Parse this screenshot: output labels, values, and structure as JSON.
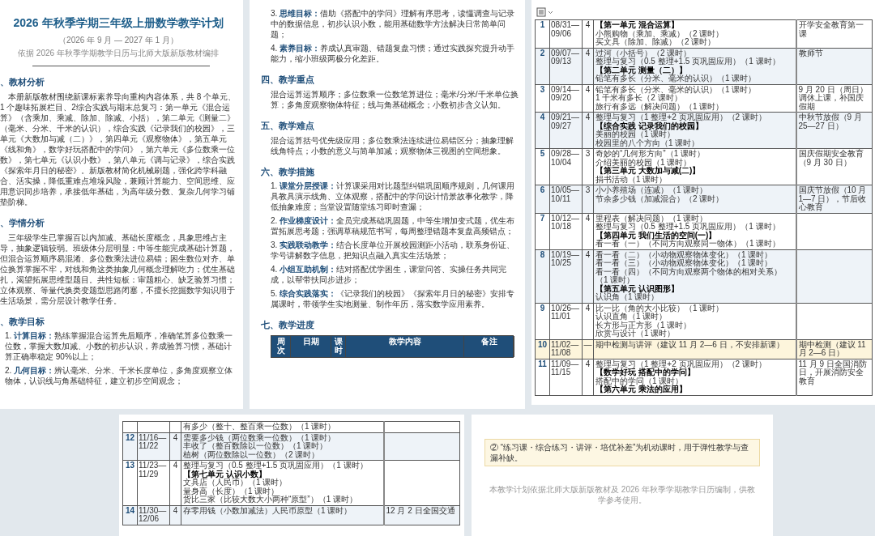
{
  "pages": [
    {
      "kind": "cover",
      "title": "2026 年秋季学期三年级上册数学教学计划",
      "subtitle": "（2026 年 9 月 — 2027 年 1 月）",
      "note": "依据 2026 年秋季学期教学日历与北师大版新版教材编排",
      "blocks": [
        {
          "kind": "heading",
          "text": "、教材分析"
        },
        {
          "kind": "para",
          "text": "本册新版教材围绕新课标素养导向重构内容体系，共 8 个单元、1 个趣味拓展栏目、2综合实践与期末总复习：第一单元《混合运算》（含乘加、乘减、除加、除减、小括），第二单元《测量二》（毫米、分米、千米的认识），综合实践《记录我们的校园》，三单元《大数加与减（二）》，第四单元《观察物体》，第五单元《线和角》，数学好玩搭配中的学问》，第六单元《多位数乘一位数》，第七单元《认识小数》，第八单元《调与记录》，综合实践《探索年月日的秘密》。新版教材简化机械刷题，强化跨学科融合、活实操，降低重难点堆垛风险，兼顾计算能力、空间思维、应用意识同步培养，承接低年基础，为高年级分数、复杂几何学习铺垫阶梯。"
        },
        {
          "kind": "heading",
          "text": "、学情分析"
        },
        {
          "kind": "para",
          "text": "三年级学生已掌握百以内加减、基础长度概念，具象思维占主导，抽象逻辑较弱。班级体分层明显：中等生能完成基础计算题，但混合运算顺序易混淆、多位数乘法进位易错；困生数位对齐、单位换算掌握不牢，对线和角这类抽象几何概念理解吃力；优生基础扎，渴望拓展思维型题目。共性短板：审题粗心、缺乏验算习惯；立体观察、等量代换类变题型思路闭塞，不擅长挖掘数学知识用于生活场景，需分层设计教学任务。"
        },
        {
          "kind": "heading",
          "text": "、教学目标"
        },
        {
          "kind": "item",
          "text": "1. **计算目标：**熟练掌握混合运算先后顺序，准确笔算多位数乘一位数，掌握大数加减、小数的初步认识，养成验算习惯，基础计算正确率稳定 90%以上；"
        },
        {
          "kind": "item",
          "text": "2. **几何目标：**辨认毫米、分米、千米长度单位，多角度观察立体物体，认识线与角基础特征，建立初步空间观念；"
        }
      ]
    },
    {
      "kind": "body",
      "blocks": [
        {
          "kind": "item",
          "text": "3. **思维目标：**借助《搭配中的学问》理解有序思考，读懂调查与记录中的数据信息，初步认识小数，能用基础数学方法解决日常简单问题；"
        },
        {
          "kind": "item",
          "text": "4. **素养目标：**养成认真审题、错题复盘习惯；通过实践探究提升动手能力，缩小班级两极分化差距。"
        },
        {
          "kind": "heading",
          "text": "四、教学重点"
        },
        {
          "kind": "para",
          "text": "混合运算运算顺序；多位数乘一位数笔算进位；毫米/分米/千米单位换算；多角度观察物体特征；线与角基础概念；小数初步含义认知。"
        },
        {
          "kind": "heading",
          "text": "五、教学难点"
        },
        {
          "kind": "para",
          "text": "混合运算括号优先级应用；多位数乘法连续进位易错区分；抽象理解线角特点；小数的意义与简单加减；观察物体三视图的空间想象。"
        },
        {
          "kind": "heading",
          "text": "六、教学措施"
        },
        {
          "kind": "item",
          "text": "1. **课堂分层授课：**计算课采用对比题型纠错巩固顺序规则，几何课用具教具演示线角、立体观察，搭配中的学问设计情景故事化教学，降低抽象难度；当堂设置随堂练习即时查漏；"
        },
        {
          "kind": "item",
          "text": "2. **作业梯度设计：**全员完成基础巩固题，中等生增加变式题，优生布置拓展思考题；强调草稿规范书写，每周整理错题本复盘高频错点；"
        },
        {
          "kind": "item",
          "text": "3. **实践联动教学：**结合长度单位开展校园测距小活动，联系身份证、学号讲解数字信息，把知识点融入真实生活场景；"
        },
        {
          "kind": "item",
          "text": "4. **小组互助机制：**结对搭配优学困生，课堂问答、实操任务共同完成，以帮带扶同步进步；"
        },
        {
          "kind": "item",
          "text": "5. **综合实践落实：**《记录我们的校园》《探索年月日的秘密》安排专属课时，带领学生实地测量、制作年历，落实数学应用素养。"
        },
        {
          "kind": "heading",
          "text": "七、教学进度"
        },
        {
          "kind": "table_header",
          "columns": [
            "周次",
            "日期",
            "课时",
            "教学内容",
            "备注"
          ]
        }
      ]
    },
    {
      "kind": "table",
      "rows": [
        {
          "week": "1",
          "dates": "08/31—09/06",
          "hours": "4",
          "highlight": false,
          "lines": [
            {
              "kind": "unit",
              "text": "【第一单元 混合运算】"
            },
            {
              "kind": "lesson",
              "text": "小熊购物（乘加、乘减）（2 课时）"
            },
            {
              "kind": "lesson",
              "text": "买文具（除加、除减）（2 课时）"
            }
          ],
          "note": "开学安全教育第一课"
        },
        {
          "week": "2",
          "dates": "09/07—09/13",
          "hours": "4",
          "highlight": false,
          "lines": [
            {
              "kind": "lesson",
              "text": "过河（小括号）（2 课时）"
            },
            {
              "kind": "lesson",
              "text": "整理与复习（0.5 整理+1.5 页巩固应用）（1 课时）"
            },
            {
              "kind": "unit",
              "text": "【第二单元 测量（二）】"
            },
            {
              "kind": "lesson",
              "text": "铅笔有多长（分米、毫米的认识）（1 课时）"
            }
          ],
          "note": "教师节"
        },
        {
          "week": "3",
          "dates": "09/14—09/20",
          "hours": "4",
          "highlight": false,
          "lines": [
            {
              "kind": "lesson",
              "text": "铅笔有多长（分米、毫米的认识）（1 课时）"
            },
            {
              "kind": "lesson",
              "text": "1 千米有多长（2 课时）"
            },
            {
              "kind": "lesson",
              "text": "旅行有多远（解决问题）（1 课时）"
            }
          ],
          "note": "9 月 20 日（周日）调休上课，补国庆假期"
        },
        {
          "week": "4",
          "dates": "09/21—09/27",
          "hours": "4",
          "highlight": false,
          "lines": [
            {
              "kind": "lesson",
              "text": "整理与复习（1 整理+2 页巩固应用）（2 课时）"
            },
            {
              "kind": "unit",
              "text": "【综合实践 记录我们的校园】"
            },
            {
              "kind": "lesson",
              "text": "美丽的校园（1 课时）"
            },
            {
              "kind": "lesson",
              "text": "校园里的八个方向（1 课时）"
            }
          ],
          "note": "中秋节放假（9 月 25—27 日）"
        },
        {
          "week": "5",
          "dates": "09/28—10/04",
          "hours": "3",
          "highlight": false,
          "lines": [
            {
              "kind": "lesson",
              "text": "奇妙的“几何形方向”（1 课时）"
            },
            {
              "kind": "lesson",
              "text": "介绍美丽的校园（1 课时）"
            },
            {
              "kind": "unit",
              "text": "【第三单元 大数加与减(二)】"
            },
            {
              "kind": "lesson",
              "text": "捐书活动（1 课时）"
            }
          ],
          "note": "国庆假期安全教育（9 月 30 日）"
        },
        {
          "week": "6",
          "dates": "10/05—10/11",
          "hours": "3",
          "highlight": false,
          "lines": [
            {
              "kind": "lesson",
              "text": "小小养殖场（连减）（1 课时）"
            },
            {
              "kind": "lesson",
              "text": "节余多少钱（加减混合）（2 课时）"
            }
          ],
          "note": "国庆节放假（10 月 1—7 日），节后收心教育"
        },
        {
          "week": "7",
          "dates": "10/12—10/18",
          "hours": "4",
          "highlight": false,
          "lines": [
            {
              "kind": "lesson",
              "text": "里程表（解决问题）（1 课时）"
            },
            {
              "kind": "lesson",
              "text": "整理与复习（0.5 整理+1.5 页巩固应用）（1 课时）"
            },
            {
              "kind": "unit",
              "text": "【第四单元 我们生活的空间(一)】"
            },
            {
              "kind": "lesson",
              "text": "看一看（一）（不同方向观察同一物体）（1 课时）"
            }
          ]
        },
        {
          "week": "8",
          "dates": "10/19—10/25",
          "hours": "4",
          "highlight": false,
          "lines": [
            {
              "kind": "lesson",
              "text": "看一看（二）（小动物观察物体变化）（1 课时）"
            },
            {
              "kind": "lesson",
              "text": "看一看（三）（小动物观察物体变化）（1 课时）"
            },
            {
              "kind": "lesson",
              "text": "看一看（四）（不同方向观察两个物体的相对关系）（1 课时）"
            },
            {
              "kind": "unit",
              "text": "【第五单元 认识图形】"
            },
            {
              "kind": "lesson",
              "text": "认识角（1 课时）"
            }
          ]
        },
        {
          "week": "9",
          "dates": "10/26—11/01",
          "hours": "4",
          "highlight": false,
          "lines": [
            {
              "kind": "lesson",
              "text": "比一比（角的大小比较）（1 课时）"
            },
            {
              "kind": "lesson",
              "text": "认识直角（1 课时）"
            },
            {
              "kind": "lesson",
              "text": "长方形与正方形（1 课时）"
            },
            {
              "kind": "lesson",
              "text": "欣赏与设计（1 课时）"
            }
          ]
        },
        {
          "week": "10",
          "dates": "11/02—11/08",
          "hours": "—",
          "highlight": true,
          "lines": [
            {
              "kind": "lesson",
              "text": "期中检测与讲评（建议 11 月 2—6 日，不安排新课）"
            }
          ],
          "note": "期中检测（建议 11 月 2—6 日）"
        },
        {
          "week": "11",
          "dates": "11/09—11/15",
          "hours": "4",
          "highlight": false,
          "lines": [
            {
              "kind": "lesson",
              "text": "整理与复习（1 整理+2 页巩固应用）（2 课时）"
            },
            {
              "kind": "unit",
              "text": "【数学好玩 搭配中的学问】"
            },
            {
              "kind": "lesson",
              "text": "搭配中的学问（1 课时）"
            },
            {
              "kind": "unit",
              "text": "【第六单元 乘法的应用】"
            }
          ],
          "note": "11 月 9 日全国消防日，开展消防安全教育"
        }
      ]
    },
    {
      "kind": "table",
      "rows": [
        {
          "highlight": false,
          "lines": [
            {
              "kind": "lesson",
              "text": "有多少（整十、整百乘一位数）（1 课时）"
            }
          ]
        },
        {
          "week": "12",
          "dates": "11/16—11/22",
          "hours": "4",
          "highlight": false,
          "lines": [
            {
              "kind": "lesson",
              "text": "需要多少钱（两位数乘一位数）（1 课时）"
            },
            {
              "kind": "lesson",
              "text": "丰收了（整百数除以一位数）（1 课时）"
            },
            {
              "kind": "lesson",
              "text": "植树（两位数除以一位数）（2 课时）"
            }
          ]
        },
        {
          "week": "13",
          "dates": "11/23—11/29",
          "hours": "4",
          "highlight": false,
          "lines": [
            {
              "kind": "lesson",
              "text": "整理与复习（0.5 整理+1.5 页巩固应用）（1 课时）"
            },
            {
              "kind": "unit",
              "text": "【第七单元 认识小数】"
            },
            {
              "kind": "lesson",
              "text": "文具店（人民币）（1 课时）"
            },
            {
              "kind": "lesson",
              "text": "量身高（长度）（1 课时）"
            },
            {
              "kind": "lesson",
              "text": "货比三家（比较大数大小两种“原型”）（1 课时）"
            }
          ]
        },
        {
          "week": "14",
          "dates": "11/30—12/06",
          "hours": "4",
          "highlight": false,
          "lines": [
            {
              "kind": "lesson",
              "text": "存零用钱（小数加减法）人民币原型（1 课时）"
            }
          ],
          "note": "12 月 2 日全国交通"
        }
      ]
    },
    {
      "kind": "end",
      "note": "② “练习课・综合练习・讲评・培优补差”为机动课时，用于弹性教学与查漏补缺。",
      "footer": "本教学计划依据北师大版新版教材及 2026 年秋季学期教学日历编制，供教学参考使用。"
    }
  ]
}
